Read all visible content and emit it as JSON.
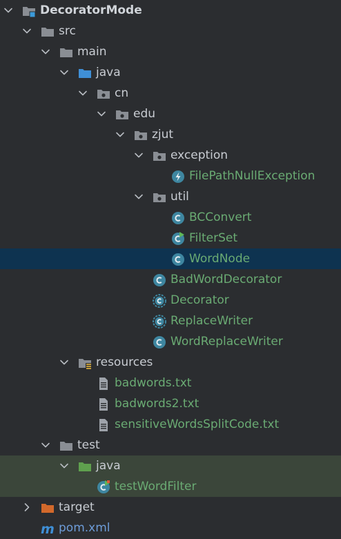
{
  "project_tree": {
    "nodes": [
      {
        "label": "DecoratorMode",
        "depth": 0,
        "expanded": true,
        "icon": "module-folder",
        "style": "bold"
      },
      {
        "label": "src",
        "depth": 1,
        "expanded": true,
        "icon": "folder",
        "style": "src"
      },
      {
        "label": "main",
        "depth": 2,
        "expanded": true,
        "icon": "folder",
        "style": "src"
      },
      {
        "label": "java",
        "depth": 3,
        "expanded": true,
        "icon": "source-root-folder",
        "style": "src"
      },
      {
        "label": "cn",
        "depth": 4,
        "expanded": true,
        "icon": "package",
        "style": "src"
      },
      {
        "label": "edu",
        "depth": 5,
        "expanded": true,
        "icon": "package",
        "style": "src"
      },
      {
        "label": "zjut",
        "depth": 6,
        "expanded": true,
        "icon": "package",
        "style": "src"
      },
      {
        "label": "exception",
        "depth": 7,
        "expanded": true,
        "icon": "package",
        "style": "src"
      },
      {
        "label": "FilePathNullException",
        "depth": 8,
        "icon": "exception-class",
        "style": "green"
      },
      {
        "label": "util",
        "depth": 7,
        "expanded": true,
        "icon": "package",
        "style": "src"
      },
      {
        "label": "BCConvert",
        "depth": 8,
        "icon": "class",
        "style": "green"
      },
      {
        "label": "FilterSet",
        "depth": 8,
        "icon": "class-runnable",
        "style": "green"
      },
      {
        "label": "WordNode",
        "depth": 8,
        "icon": "class",
        "style": "green",
        "selected": true
      },
      {
        "label": "BadWordDecorator",
        "depth": 7,
        "icon": "class",
        "style": "green"
      },
      {
        "label": "Decorator",
        "depth": 7,
        "icon": "abstract-class",
        "style": "green"
      },
      {
        "label": "ReplaceWriter",
        "depth": 7,
        "icon": "abstract-class",
        "style": "green"
      },
      {
        "label": "WordReplaceWriter",
        "depth": 7,
        "icon": "class",
        "style": "green"
      },
      {
        "label": "resources",
        "depth": 3,
        "expanded": true,
        "icon": "resources-folder",
        "style": "src"
      },
      {
        "label": "badwords.txt",
        "depth": 4,
        "icon": "text-file",
        "style": "green"
      },
      {
        "label": "badwords2.txt",
        "depth": 4,
        "icon": "text-file",
        "style": "green"
      },
      {
        "label": "sensitiveWordsSplitCode.txt",
        "depth": 4,
        "icon": "text-file",
        "style": "green"
      },
      {
        "label": "test",
        "depth": 2,
        "expanded": true,
        "icon": "folder",
        "style": "src"
      },
      {
        "label": "java",
        "depth": 3,
        "expanded": true,
        "icon": "test-root-folder",
        "style": "src",
        "highlight": "test"
      },
      {
        "label": "testWordFilter",
        "depth": 4,
        "icon": "test-class",
        "style": "green",
        "highlight": "test"
      },
      {
        "label": "target",
        "depth": 1,
        "expanded": false,
        "icon": "excluded-folder",
        "style": "src"
      },
      {
        "label": "pom.xml",
        "depth": 1,
        "icon": "maven-icon",
        "style": "blue"
      }
    ]
  },
  "colors": {
    "background": "#2b2d30",
    "selection": "#0e3350",
    "test_highlight": "#3b463a",
    "class_icon": "#3e86a0",
    "folder": "#8a8e94",
    "source_root": "#3f8fd6",
    "test_root": "#5fa04e",
    "excluded": "#d2692b",
    "file_green": "#6aab73"
  }
}
